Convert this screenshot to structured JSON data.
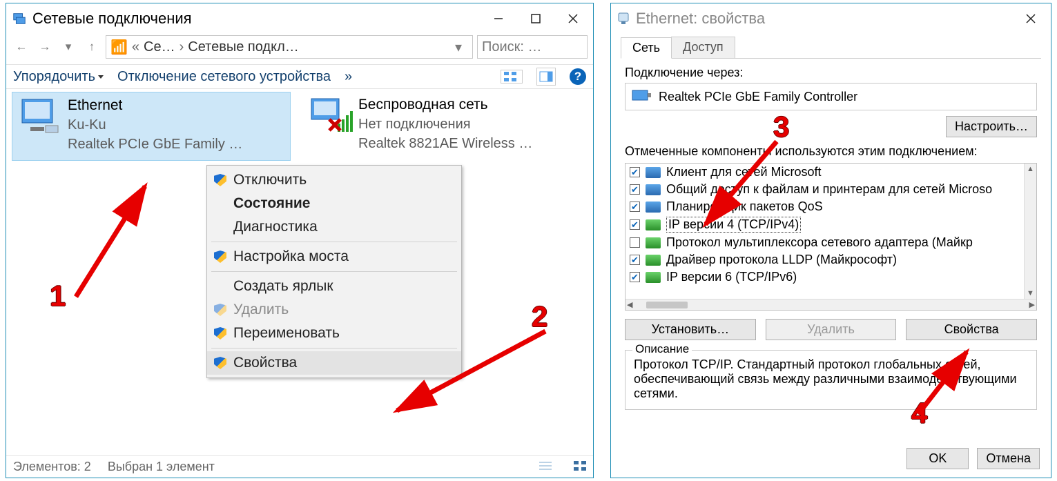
{
  "win1": {
    "title": "Сетевые подключения",
    "path": {
      "folder_icon": "folder-icon",
      "crumb1": "Се…",
      "crumb2": "Сетевые подкл…"
    },
    "search": {
      "placeholder": "Поиск: …"
    },
    "toolbar": {
      "sort": "Упорядочить",
      "disable": "Отключение сетевого устройства",
      "more": "»"
    },
    "tiles": [
      {
        "name": "Ethernet",
        "line2": "Ku-Ku",
        "line3": "Realtek PCIe GbE Family …",
        "selected": true
      },
      {
        "name": "Беспроводная сеть",
        "line2": "Нет подключения",
        "line3": "Realtek 8821AE Wireless …",
        "selected": false
      }
    ],
    "ctx": {
      "disable": "Отключить",
      "status": "Состояние",
      "diag": "Диагностика",
      "bridge": "Настройка моста",
      "shortcut": "Создать ярлык",
      "delete": "Удалить",
      "rename": "Переименовать",
      "props": "Свойства"
    },
    "status": {
      "count": "Элементов: 2",
      "sel": "Выбран 1 элемент"
    }
  },
  "win2": {
    "title": "Ethernet: свойства",
    "tabs": {
      "net": "Сеть",
      "share": "Доступ"
    },
    "connect_via_label": "Подключение через:",
    "adapter": "Realtek PCIe GbE Family Controller",
    "configure": "Настроить…",
    "components_label": "Отмеченные компоненты используются этим подключением:",
    "components": [
      {
        "checked": true,
        "icon": "blue",
        "label": "Клиент для сетей Microsoft"
      },
      {
        "checked": true,
        "icon": "blue",
        "label": "Общий доступ к файлам и принтерам для сетей Microso"
      },
      {
        "checked": true,
        "icon": "blue",
        "label": "Планировщик пакетов QoS"
      },
      {
        "checked": true,
        "icon": "green",
        "label": "IP версии 4 (TCP/IPv4)",
        "selected": true
      },
      {
        "checked": false,
        "icon": "green",
        "label": "Протокол мультиплексора сетевого адаптера (Майкр"
      },
      {
        "checked": true,
        "icon": "green",
        "label": "Драйвер протокола LLDP (Майкрософт)"
      },
      {
        "checked": true,
        "icon": "green",
        "label": "IP версии 6 (TCP/IPv6)"
      }
    ],
    "install": "Установить…",
    "uninstall": "Удалить",
    "props": "Свойства",
    "desc_legend": "Описание",
    "desc_text": "Протокол TCP/IP. Стандартный протокол глобальных сетей, обеспечивающий связь между различными взаимодействующими сетями.",
    "ok": "OK",
    "cancel": "Отмена"
  },
  "steps": {
    "s1": "1",
    "s2": "2",
    "s3": "3",
    "s4": "4"
  }
}
